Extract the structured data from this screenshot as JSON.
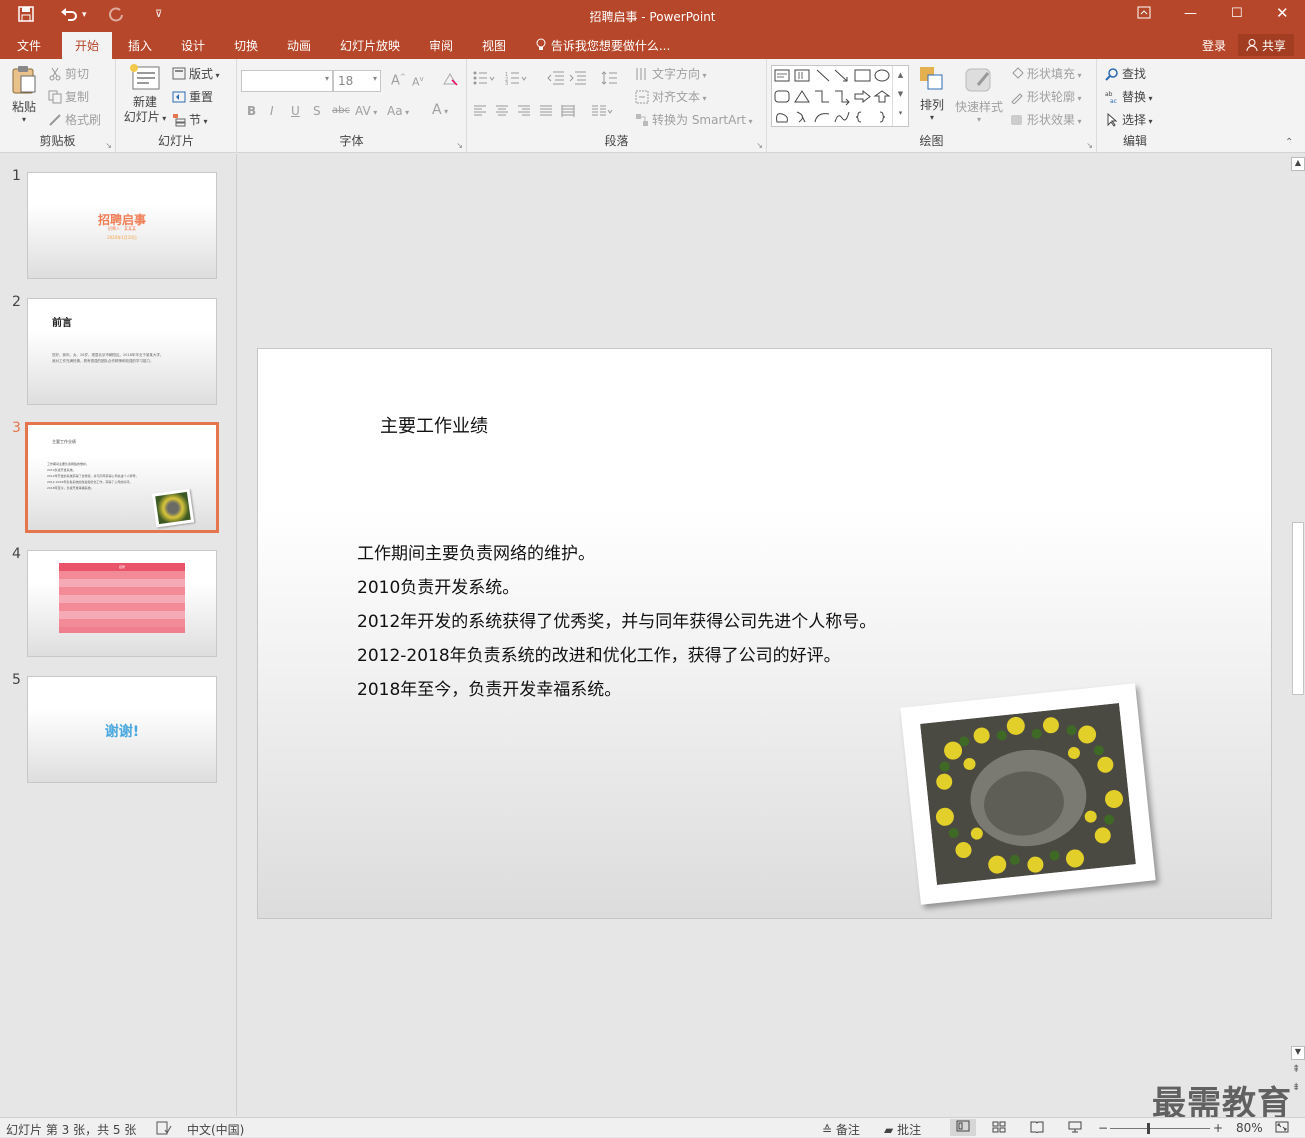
{
  "app": {
    "title": "招聘启事 - PowerPoint"
  },
  "qat": {
    "save_icon": "save-icon",
    "undo_icon": "undo-icon",
    "redo_icon": "redo-icon",
    "customize_icon": "qat-customize-icon"
  },
  "tabs": [
    "文件",
    "开始",
    "插入",
    "设计",
    "切换",
    "动画",
    "幻灯片放映",
    "审阅",
    "视图"
  ],
  "tell_me": "告诉我您想要做什么...",
  "account": {
    "login": "登录",
    "share": "共享"
  },
  "ribbon": {
    "clipboard": {
      "paste": "粘贴",
      "cut": "剪切",
      "copy": "复制",
      "format_painter": "格式刷",
      "label": "剪贴板"
    },
    "slides": {
      "new_slide_line1": "新建",
      "new_slide_line2": "幻灯片",
      "layout": "版式",
      "reset": "重置",
      "section": "节",
      "label": "幻灯片"
    },
    "font": {
      "font_name": "",
      "font_size": "18",
      "bold": "B",
      "italic": "I",
      "underline": "U",
      "shadow": "S",
      "strike": "abc",
      "spacing": "AV",
      "case": "Aa",
      "color": "A",
      "grow": "A",
      "shrink": "A",
      "label": "字体"
    },
    "paragraph": {
      "text_direction": "文字方向",
      "align_text": "对齐文本",
      "smartart": "转换为 SmartArt",
      "label": "段落"
    },
    "drawing": {
      "arrange": "排列",
      "quick_styles": "快速样式",
      "shape_fill": "形状填充",
      "shape_outline": "形状轮廓",
      "shape_effects": "形状效果",
      "label": "绘图"
    },
    "editing": {
      "find": "查找",
      "replace": "替换",
      "select": "选择",
      "label": "编辑"
    }
  },
  "thumbnails": [
    {
      "num": "1",
      "title": "招聘启事",
      "sub1": "招聘人：某某某",
      "sub2": "2020年1月10日"
    },
    {
      "num": "2",
      "title": "前言",
      "body1": "您好，我叫、女、26岁、现居北京市朝阳区。2018年毕业于某某大学。",
      "body2": "我对工作充满热情，具有很强的团队合作精神和较强的学习能力。"
    },
    {
      "num": "3",
      "title": "主要工作业绩",
      "lines": [
        "工作期间主要负责网络的维护。",
        "2010负责开发系统。",
        "2012年开发的系统获得了优秀奖，并与同年获得公司先进个人称号。",
        "2012-2018年负责系统的改进和优化工作，获得了公司的好评。",
        "2018年至今，负责开发幸福系统。"
      ]
    },
    {
      "num": "4",
      "table_title": "招聘"
    },
    {
      "num": "5",
      "title": "谢谢!"
    }
  ],
  "slide": {
    "title": "主要工作业绩",
    "lines": [
      "工作期间主要负责网络的维护。",
      "2010负责开发系统。",
      "2012年开发的系统获得了优秀奖，并与同年获得公司先进个人称号。",
      "2012-2018年负责系统的改进和优化工作，获得了公司的好评。",
      "2018年至今，负责开发幸福系统。"
    ]
  },
  "statusbar": {
    "slide_info": "幻灯片 第 3 张，共 5 张",
    "language": "中文(中国)",
    "notes": "备注",
    "comments": "批注",
    "zoom": "80%"
  },
  "watermark": "最需教育",
  "colors": {
    "accent": "#b7472a",
    "selected_thumb": "#e5754c"
  }
}
